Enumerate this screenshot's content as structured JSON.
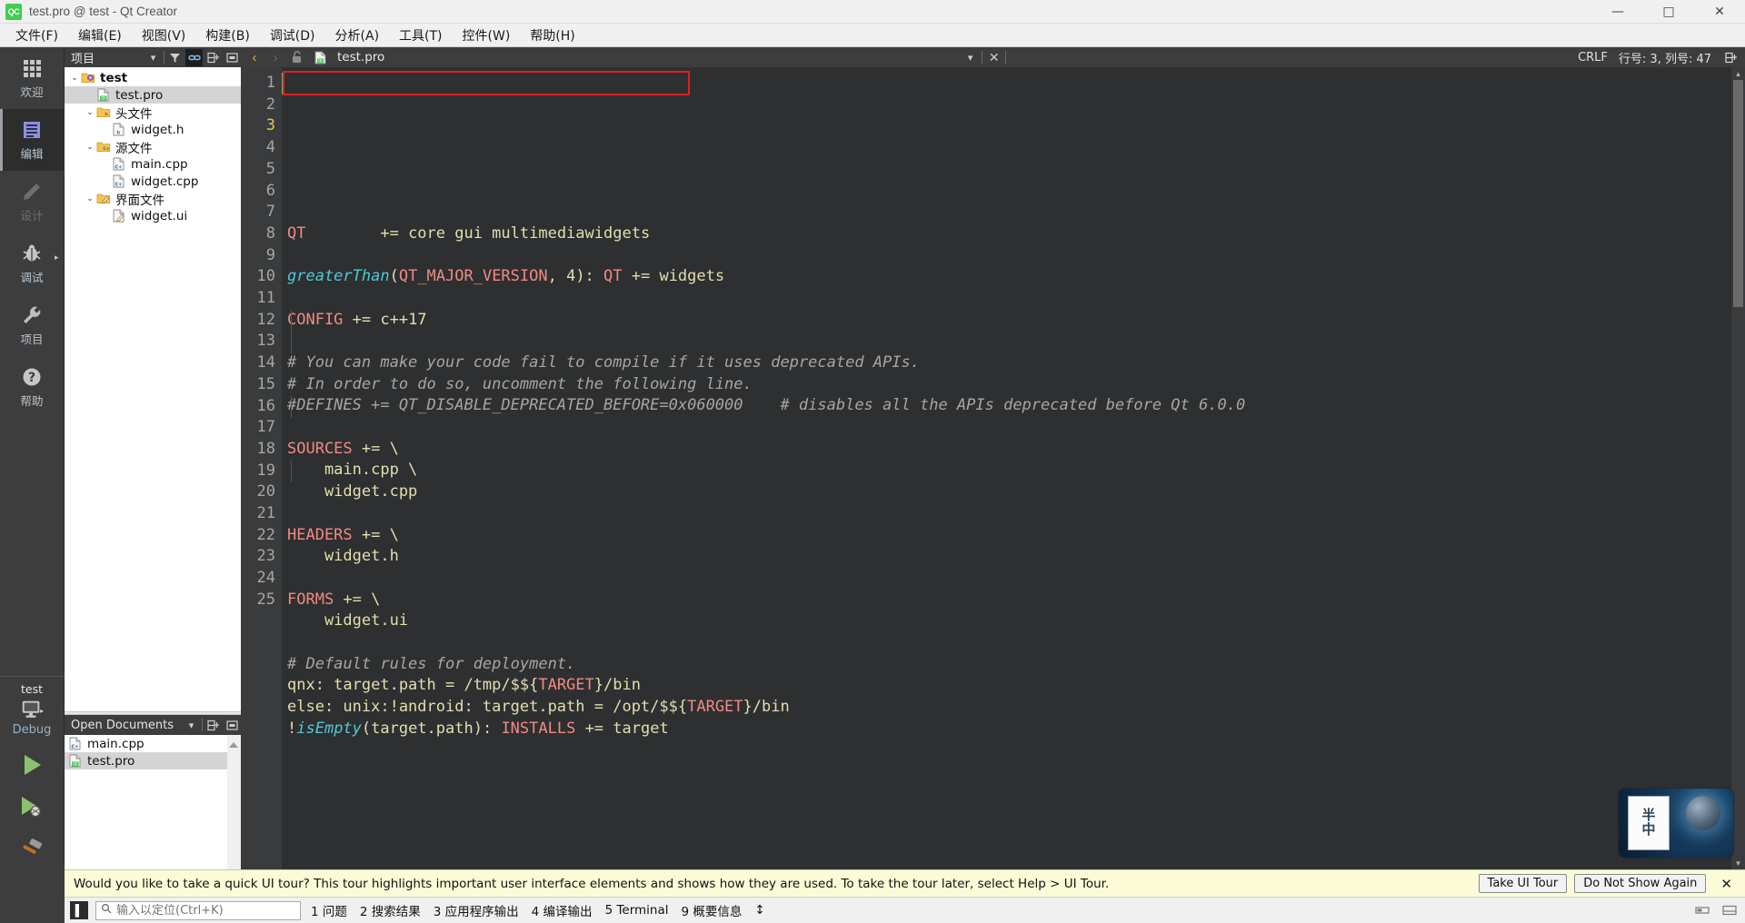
{
  "window": {
    "title": "test.pro @ test - Qt Creator",
    "logo_text": "QC",
    "minimize": "—",
    "maximize": "□",
    "close": "✕"
  },
  "menubar": {
    "items": [
      {
        "label": "文件(F)",
        "name": "menu-file"
      },
      {
        "label": "编辑(E)",
        "name": "menu-edit"
      },
      {
        "label": "视图(V)",
        "name": "menu-view"
      },
      {
        "label": "构建(B)",
        "name": "menu-build"
      },
      {
        "label": "调试(D)",
        "name": "menu-debug"
      },
      {
        "label": "分析(A)",
        "name": "menu-analyze"
      },
      {
        "label": "工具(T)",
        "name": "menu-tools"
      },
      {
        "label": "控件(W)",
        "name": "menu-widgets"
      },
      {
        "label": "帮助(H)",
        "name": "menu-help"
      }
    ]
  },
  "modebar": {
    "items": [
      {
        "label": "欢迎",
        "icon": "grid-icon",
        "active": false,
        "dim": false
      },
      {
        "label": "编辑",
        "icon": "edit-icon",
        "active": true,
        "dim": false
      },
      {
        "label": "设计",
        "icon": "pencil-icon",
        "active": false,
        "dim": true
      },
      {
        "label": "调试",
        "icon": "bug-icon",
        "active": false,
        "dim": false
      },
      {
        "label": "项目",
        "icon": "wrench-icon",
        "active": false,
        "dim": false
      },
      {
        "label": "帮助",
        "icon": "question-icon",
        "active": false,
        "dim": false
      }
    ],
    "kit": {
      "project": "test",
      "build_config": "Debug",
      "run_label": "run-button",
      "debug_label": "debug-button",
      "build_label": "build-button"
    }
  },
  "project_dock": {
    "title": "项目",
    "toolbar": [
      "filter-icon",
      "link-icon",
      "split-icon",
      "collapse-icon"
    ],
    "tree": [
      {
        "label": "test",
        "indent": 0,
        "arrow": "⌄",
        "icon": "qt-project-icon",
        "selected": false,
        "bold": true
      },
      {
        "label": "test.pro",
        "indent": 1,
        "arrow": "",
        "icon": "pro-file-icon",
        "selected": true,
        "bold": false
      },
      {
        "label": "头文件",
        "indent": 1,
        "arrow": "⌄",
        "icon": "folder-h-icon",
        "selected": false,
        "bold": false
      },
      {
        "label": "widget.h",
        "indent": 2,
        "arrow": "",
        "icon": "header-file-icon",
        "selected": false,
        "bold": false
      },
      {
        "label": "源文件",
        "indent": 1,
        "arrow": "⌄",
        "icon": "folder-cpp-icon",
        "selected": false,
        "bold": false
      },
      {
        "label": "main.cpp",
        "indent": 2,
        "arrow": "",
        "icon": "cpp-file-icon",
        "selected": false,
        "bold": false
      },
      {
        "label": "widget.cpp",
        "indent": 2,
        "arrow": "",
        "icon": "cpp-file-icon",
        "selected": false,
        "bold": false
      },
      {
        "label": "界面文件",
        "indent": 1,
        "arrow": "⌄",
        "icon": "folder-ui-icon",
        "selected": false,
        "bold": false
      },
      {
        "label": "widget.ui",
        "indent": 2,
        "arrow": "",
        "icon": "ui-file-icon",
        "selected": false,
        "bold": false
      }
    ]
  },
  "open_documents": {
    "title": "Open Documents",
    "items": [
      {
        "label": "main.cpp",
        "icon": "cpp-file-icon",
        "selected": false
      },
      {
        "label": "test.pro",
        "icon": "pro-file-icon",
        "selected": true
      }
    ]
  },
  "editor_toolbar": {
    "back": "‹",
    "forward": "›",
    "lock_icon": "unlocked-icon",
    "document": "test.pro",
    "dropdown": "▾",
    "close": "✕",
    "line_ending": "CRLF",
    "cursor_position": "行号: 3, 列号: 47",
    "split_icon": "split-icon"
  },
  "editor": {
    "total_lines": 25,
    "current_line": 3,
    "lines": [
      {
        "n": 1,
        "tokens": [
          {
            "t": "QT",
            "c": "k"
          },
          {
            "t": "        += core gui multimediawidgets",
            "c": "pl"
          }
        ]
      },
      {
        "n": 2,
        "tokens": []
      },
      {
        "n": 3,
        "tokens": [
          {
            "t": "greaterThan",
            "c": "fn"
          },
          {
            "t": "(",
            "c": "pl"
          },
          {
            "t": "QT_MAJOR_VERSION",
            "c": "k"
          },
          {
            "t": ", 4): ",
            "c": "pl"
          },
          {
            "t": "QT",
            "c": "k"
          },
          {
            "t": " += widgets",
            "c": "pl"
          }
        ]
      },
      {
        "n": 4,
        "tokens": []
      },
      {
        "n": 5,
        "tokens": [
          {
            "t": "CONFIG",
            "c": "k"
          },
          {
            "t": " += c++17",
            "c": "pl"
          }
        ]
      },
      {
        "n": 6,
        "tokens": []
      },
      {
        "n": 7,
        "tokens": [
          {
            "t": "# You can make your code fail to compile if it uses deprecated APIs.",
            "c": "cm"
          }
        ]
      },
      {
        "n": 8,
        "tokens": [
          {
            "t": "# In order to do so, uncomment the following line.",
            "c": "cm"
          }
        ]
      },
      {
        "n": 9,
        "tokens": [
          {
            "t": "#DEFINES += QT_DISABLE_DEPRECATED_BEFORE=0x060000    # disables all the APIs deprecated before Qt 6.0.0",
            "c": "cm"
          }
        ]
      },
      {
        "n": 10,
        "tokens": []
      },
      {
        "n": 11,
        "tokens": [
          {
            "t": "SOURCES",
            "c": "k"
          },
          {
            "t": " += \\",
            "c": "pl"
          }
        ]
      },
      {
        "n": 12,
        "tokens": [
          {
            "t": "    main.cpp \\",
            "c": "pl"
          }
        ]
      },
      {
        "n": 13,
        "tokens": [
          {
            "t": "    widget.cpp",
            "c": "pl"
          }
        ]
      },
      {
        "n": 14,
        "tokens": []
      },
      {
        "n": 15,
        "tokens": [
          {
            "t": "HEADERS",
            "c": "k"
          },
          {
            "t": " += \\",
            "c": "pl"
          }
        ]
      },
      {
        "n": 16,
        "tokens": [
          {
            "t": "    widget.h",
            "c": "pl"
          }
        ]
      },
      {
        "n": 17,
        "tokens": []
      },
      {
        "n": 18,
        "tokens": [
          {
            "t": "FORMS",
            "c": "k"
          },
          {
            "t": " += \\",
            "c": "pl"
          }
        ]
      },
      {
        "n": 19,
        "tokens": [
          {
            "t": "    widget.ui",
            "c": "pl"
          }
        ]
      },
      {
        "n": 20,
        "tokens": []
      },
      {
        "n": 21,
        "tokens": [
          {
            "t": "# Default rules for deployment.",
            "c": "cm"
          }
        ]
      },
      {
        "n": 22,
        "tokens": [
          {
            "t": "qnx: target.path = /tmp/$${",
            "c": "pl"
          },
          {
            "t": "TARGET",
            "c": "k"
          },
          {
            "t": "}/bin",
            "c": "pl"
          }
        ]
      },
      {
        "n": 23,
        "tokens": [
          {
            "t": "else: unix:!android: target.path = /opt/$${",
            "c": "pl"
          },
          {
            "t": "TARGET",
            "c": "k"
          },
          {
            "t": "}/bin",
            "c": "pl"
          }
        ]
      },
      {
        "n": 24,
        "tokens": [
          {
            "t": "!",
            "c": "pl"
          },
          {
            "t": "isEmpty",
            "c": "fn"
          },
          {
            "t": "(target.path): ",
            "c": "pl"
          },
          {
            "t": "INSTALLS",
            "c": "k"
          },
          {
            "t": " += target",
            "c": "pl"
          }
        ]
      },
      {
        "n": 25,
        "tokens": []
      }
    ],
    "highlight_box": {
      "line": 1,
      "label": "qt-modules-highlight"
    },
    "watermark": {
      "card_top": "半",
      "card_bottom": "中"
    }
  },
  "notification": {
    "message": "Would you like to take a quick UI tour? This tour highlights important user interface elements and shows how they are used. To take the tour later, select Help > UI Tour.",
    "primary_button": "Take UI Tour",
    "secondary_button": "Do Not Show Again",
    "close": "✕"
  },
  "statusbar": {
    "sidebar_toggle": "▌",
    "locator_placeholder": "输入以定位(Ctrl+K)",
    "locator_value": "",
    "items": [
      {
        "label": "1 问题",
        "name": "status-issues"
      },
      {
        "label": "2 搜索结果",
        "name": "status-search-results"
      },
      {
        "label": "3 应用程序输出",
        "name": "status-app-output"
      },
      {
        "label": "4 编译输出",
        "name": "status-compile-output"
      },
      {
        "label": "5 Terminal",
        "name": "status-terminal"
      },
      {
        "label": "9 概要信息",
        "name": "status-overview"
      }
    ],
    "more": "↕"
  },
  "colors": {
    "accent_green": "#41cd52",
    "keyword": "#f08a84",
    "function": "#4ec9d8",
    "comment": "#a6a6a6",
    "plain": "#e3dfaf",
    "highlight_box": "#e02020",
    "editor_bg": "#2e2f30"
  }
}
